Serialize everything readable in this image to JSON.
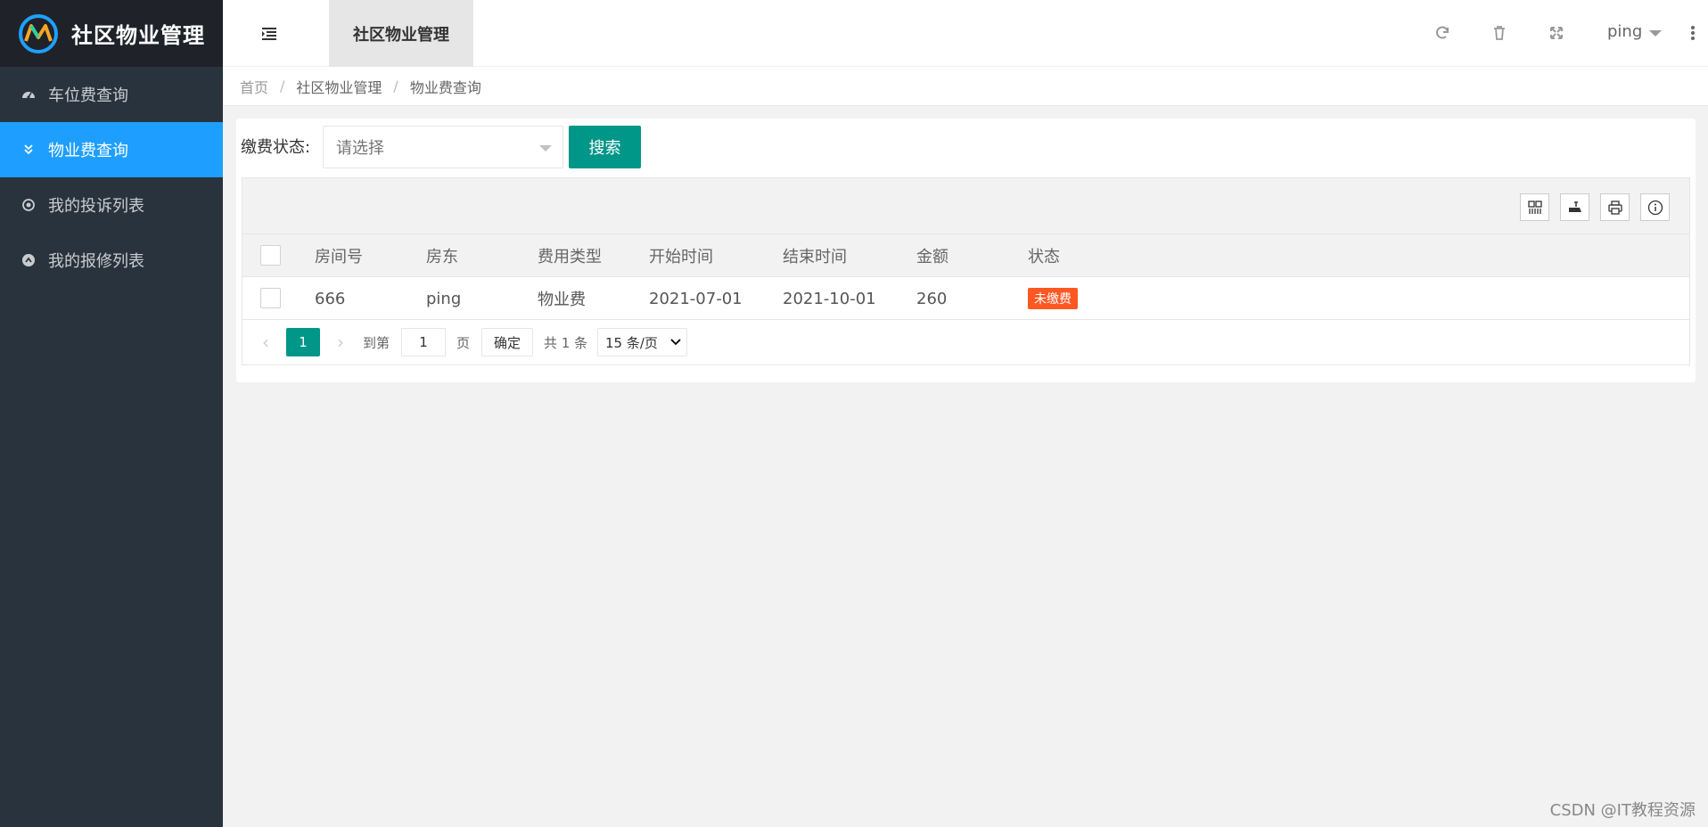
{
  "app": {
    "title": "社区物业管理"
  },
  "sidebar": {
    "items": [
      {
        "label": "车位费查询",
        "icon": "dashboard-icon"
      },
      {
        "label": "物业费查询",
        "icon": "double-chevron-down-icon",
        "active": true
      },
      {
        "label": "我的投诉列表",
        "icon": "target-circle-icon"
      },
      {
        "label": "我的报修列表",
        "icon": "up-circle-icon"
      }
    ]
  },
  "header": {
    "tab_label": "社区物业管理",
    "user_name": "ping"
  },
  "breadcrumb": [
    "首页",
    "社区物业管理",
    "物业费查询"
  ],
  "filter": {
    "label": "缴费状态:",
    "select_placeholder": "请选择",
    "search_label": "搜索"
  },
  "table": {
    "columns": [
      "房间号",
      "房东",
      "费用类型",
      "开始时间",
      "结束时间",
      "金额",
      "状态"
    ],
    "rows": [
      {
        "room": "666",
        "owner": "ping",
        "fee_type": "物业费",
        "start": "2021-07-01",
        "end": "2021-10-01",
        "amount": "260",
        "status": "未缴费"
      }
    ]
  },
  "pager": {
    "current": "1",
    "goto_label": "到第",
    "goto_value": "1",
    "page_unit": "页",
    "confirm_label": "确定",
    "total": "共 1 条",
    "page_size": "15 条/页"
  },
  "watermark": "CSDN @IT教程资源",
  "colors": {
    "sidebar_bg": "#28333e",
    "active": "#1e9fff",
    "primary": "#009688",
    "status_unpaid": "#ff5722"
  }
}
